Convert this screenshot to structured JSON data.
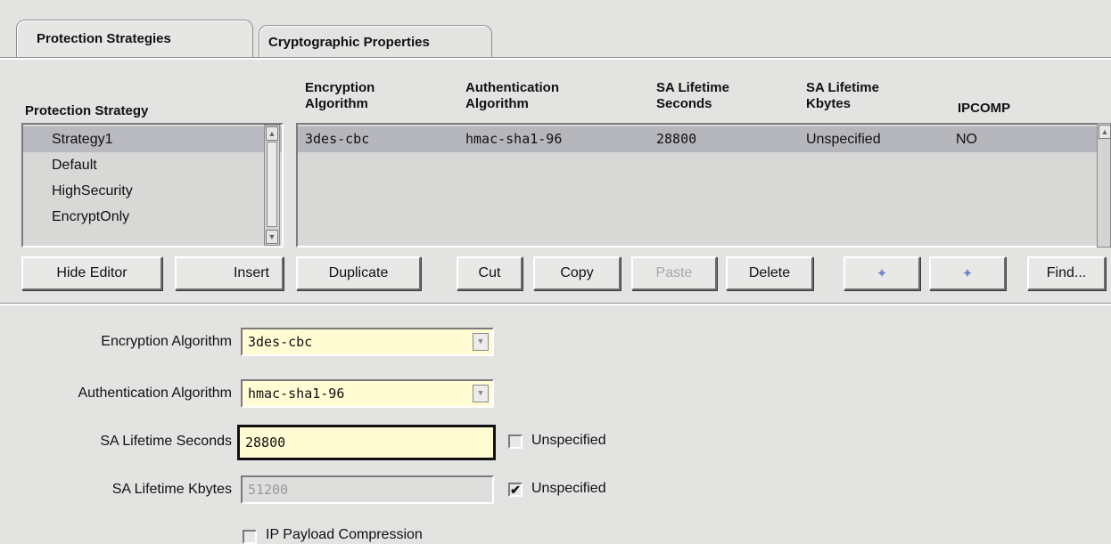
{
  "tabs": [
    {
      "label": "Protection Strategies"
    },
    {
      "label": "Cryptographic Properties"
    }
  ],
  "strategy_list": {
    "header": "Protection Strategy",
    "items": [
      "Strategy1",
      "Default",
      "HighSecurity",
      "EncryptOnly"
    ],
    "selected": "Strategy1"
  },
  "properties_table": {
    "headers": {
      "encryption": [
        "Encryption",
        "Algorithm"
      ],
      "authentication": [
        "Authentication",
        "Algorithm"
      ],
      "sa_seconds": [
        "SA Lifetime",
        "Seconds"
      ],
      "sa_kbytes": [
        "SA Lifetime",
        "Kbytes"
      ],
      "ipcomp": "IPCOMP"
    },
    "rows": [
      {
        "encryption": "3des-cbc",
        "authentication": "hmac-sha1-96",
        "sa_seconds": "28800",
        "sa_kbytes": "Unspecified",
        "ipcomp": "NO"
      }
    ]
  },
  "toolbar": {
    "hide_editor": "Hide Editor",
    "insert": "Insert",
    "duplicate": "Duplicate",
    "cut": "Cut",
    "copy": "Copy",
    "paste": "Paste",
    "delete": "Delete",
    "up_icon": "arrow-up-icon",
    "down_icon": "arrow-down-icon",
    "find": "Find..."
  },
  "form": {
    "encryption_label": "Encryption Algorithm",
    "encryption_value": "3des-cbc",
    "authentication_label": "Authentication Algorithm",
    "authentication_value": "hmac-sha1-96",
    "sa_seconds_label": "SA Lifetime Seconds",
    "sa_seconds_value": "28800",
    "sa_seconds_unspecified_label": "Unspecified",
    "sa_seconds_unspecified_checked": false,
    "sa_kbytes_label": "SA Lifetime Kbytes",
    "sa_kbytes_value": "51200",
    "sa_kbytes_unspecified_label": "Unspecified",
    "sa_kbytes_unspecified_checked": true,
    "ip_payload_label": "IP Payload Compression",
    "ip_payload_checked": false
  },
  "colors": {
    "background": "#e3e3e1",
    "field_yellow": "#fffbd2",
    "selection": "#b9b9c0",
    "arrow_blue": "#6f86c9"
  }
}
